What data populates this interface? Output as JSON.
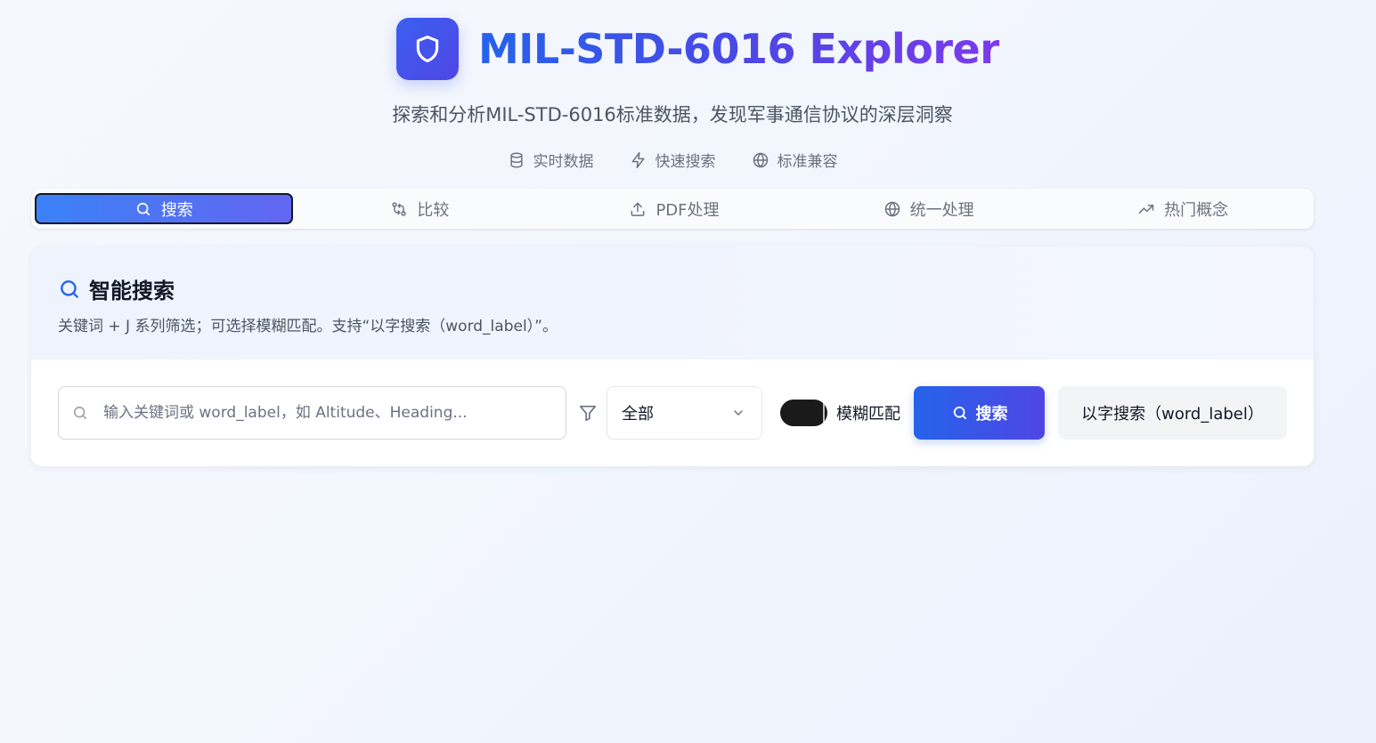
{
  "header": {
    "title": "MIL-STD-6016 Explorer",
    "subtitle": "探索和分析MIL-STD-6016标准数据，发现军事通信协议的深层洞察",
    "features": [
      {
        "label": "实时数据",
        "icon": "database-icon"
      },
      {
        "label": "快速搜索",
        "icon": "lightning-icon"
      },
      {
        "label": "标准兼容",
        "icon": "globe-icon"
      }
    ],
    "logo_icon": "shield-icon"
  },
  "tabs": [
    {
      "label": "搜索",
      "icon": "search-icon",
      "active": true
    },
    {
      "label": "比较",
      "icon": "compare-icon",
      "active": false
    },
    {
      "label": "PDF处理",
      "icon": "upload-icon",
      "active": false
    },
    {
      "label": "统一处理",
      "icon": "globe-icon",
      "active": false
    },
    {
      "label": "热门概念",
      "icon": "trending-icon",
      "active": false
    }
  ],
  "search_panel": {
    "title": "智能搜索",
    "description": "关键词 + J 系列筛选；可选择模糊匹配。支持“以字搜索（word_label）”。",
    "input_value": "",
    "input_placeholder": "输入关键词或 word_label，如 Altitude、Heading...",
    "filter_selected": "全部",
    "fuzzy_label": "模糊匹配",
    "fuzzy_enabled": true,
    "search_button": "搜索",
    "word_search_button": "以字搜索（word_label）"
  },
  "colors": {
    "accent": "#2563eb",
    "accent_secondary": "#4f46e5",
    "title_gradient_end": "#7c3aed",
    "toggle_on": "#1a1a1a"
  }
}
